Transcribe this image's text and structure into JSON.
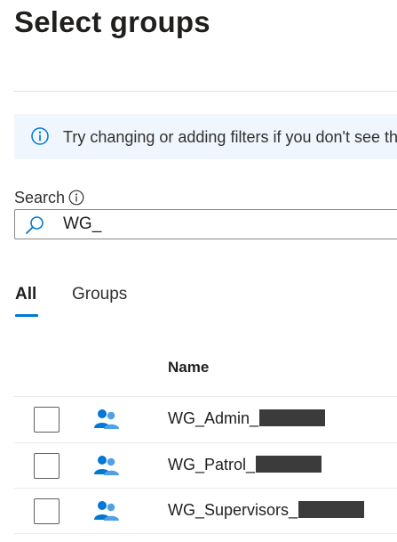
{
  "panel": {
    "title": "Select groups"
  },
  "info_bar": {
    "message": "Try changing or adding filters if you don't see the group you're looking for."
  },
  "search": {
    "label": "Search",
    "value": "WG_"
  },
  "tabs": [
    {
      "label": "All",
      "selected": true
    },
    {
      "label": "Groups",
      "selected": false
    }
  ],
  "table": {
    "columns": [
      "Name"
    ],
    "rows": [
      {
        "name": "WG_Admin_",
        "checked": false
      },
      {
        "name": "WG_Patrol_",
        "checked": false
      },
      {
        "name": "WG_Supervisors_",
        "checked": false
      }
    ]
  },
  "colors": {
    "accent": "#0078d4",
    "info_background": "#f0f6fd",
    "group_icon": "#0078d4"
  },
  "icons": {
    "info": "info-icon",
    "search": "search-icon",
    "group": "group-icon"
  }
}
